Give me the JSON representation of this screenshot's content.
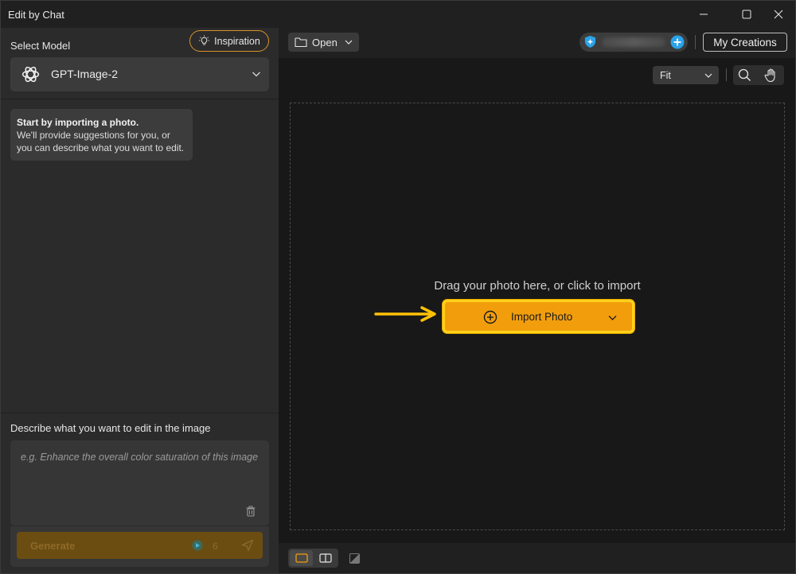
{
  "window": {
    "title": "Edit by Chat"
  },
  "left_panel": {
    "select_model_label": "Select Model",
    "inspiration_label": "Inspiration",
    "model": {
      "selected": "GPT-Image-2"
    },
    "hint": {
      "title": "Start by importing a photo.",
      "body": "We'll provide suggestions for you, or you can describe what you want to edit."
    },
    "prompt": {
      "label": "Describe what you want to edit in the image",
      "value": "",
      "placeholder": "e.g. Enhance the overall color saturation of this image"
    },
    "generate": {
      "label": "Generate",
      "credits": "6"
    }
  },
  "toolbar": {
    "open_label": "Open",
    "my_creations_label": "My Creations"
  },
  "canvas": {
    "fit_label": "Fit",
    "drop_text": "Drag your photo here, or click to import",
    "import_label": "Import Photo"
  },
  "colors": {
    "accent": "#f29e0c",
    "highlight": "#ffd21a",
    "inspiration_border": "#d9922a"
  },
  "icons": {
    "inspiration": "lightbulb-icon",
    "model": "openai-logo-icon",
    "open": "folder-icon",
    "account": "shield-icon",
    "add_credits": "plus-circle-icon",
    "zoom": "search-icon",
    "pan": "hand-icon",
    "import": "plus-circle-icon",
    "delete": "trash-icon",
    "send": "send-icon"
  }
}
